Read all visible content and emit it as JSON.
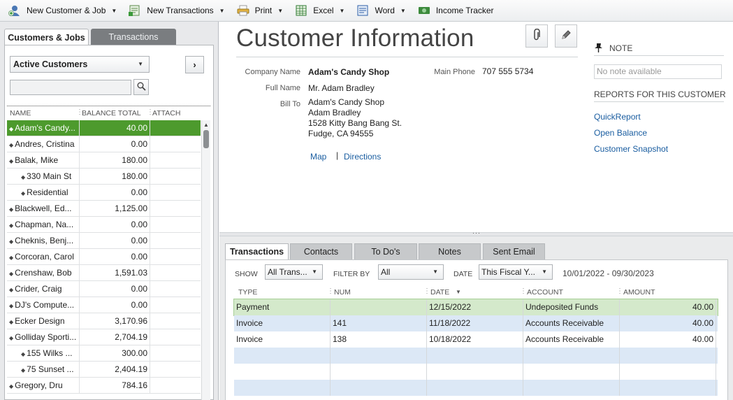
{
  "toolbar": {
    "items": [
      {
        "label": "New Customer & Job",
        "icon": "new-customer-icon",
        "has_menu": true
      },
      {
        "label": "New Transactions",
        "icon": "new-transactions-icon",
        "has_menu": true
      },
      {
        "label": "Print",
        "icon": "print-icon",
        "has_menu": true
      },
      {
        "label": "Excel",
        "icon": "excel-icon",
        "has_menu": true
      },
      {
        "label": "Word",
        "icon": "word-icon",
        "has_menu": true
      },
      {
        "label": "Income Tracker",
        "icon": "income-tracker-icon",
        "has_menu": false
      }
    ]
  },
  "left": {
    "tabs": {
      "customers_jobs": "Customers & Jobs",
      "transactions": "Transactions"
    },
    "filter": "Active Customers",
    "search_value": "",
    "columns": {
      "name": "NAME",
      "balance": "BALANCE TOTAL",
      "attach": "ATTACH"
    },
    "rows": [
      {
        "name": "Adam's Candy...",
        "balance": "40.00",
        "sub": false,
        "selected": true
      },
      {
        "name": "Andres, Cristina",
        "balance": "0.00",
        "sub": false
      },
      {
        "name": "Balak, Mike",
        "balance": "180.00",
        "sub": false
      },
      {
        "name": "330 Main St",
        "balance": "180.00",
        "sub": true
      },
      {
        "name": "Residential",
        "balance": "0.00",
        "sub": true
      },
      {
        "name": "Blackwell, Ed...",
        "balance": "1,125.00",
        "sub": false
      },
      {
        "name": "Chapman, Na...",
        "balance": "0.00",
        "sub": false
      },
      {
        "name": "Cheknis, Benj...",
        "balance": "0.00",
        "sub": false
      },
      {
        "name": "Corcoran, Carol",
        "balance": "0.00",
        "sub": false
      },
      {
        "name": "Crenshaw, Bob",
        "balance": "1,591.03",
        "sub": false
      },
      {
        "name": "Crider, Craig",
        "balance": "0.00",
        "sub": false
      },
      {
        "name": "DJ's Compute...",
        "balance": "0.00",
        "sub": false
      },
      {
        "name": "Ecker Design",
        "balance": "3,170.96",
        "sub": false
      },
      {
        "name": "Golliday Sporti...",
        "balance": "2,704.19",
        "sub": false
      },
      {
        "name": "155 Wilks ...",
        "balance": "300.00",
        "sub": true
      },
      {
        "name": "75 Sunset ...",
        "balance": "2,404.19",
        "sub": true
      },
      {
        "name": "Gregory, Dru",
        "balance": "784.16",
        "sub": false
      }
    ]
  },
  "info": {
    "title": "Customer Information",
    "labels": {
      "company": "Company Name",
      "full_name": "Full Name",
      "bill_to": "Bill To",
      "phone": "Main Phone"
    },
    "company": "Adam's Candy Shop",
    "full_name": "Mr. Adam  Bradley",
    "bill_to": [
      "Adam's Candy Shop",
      "Adam Bradley",
      "1528 Kitty Bang Bang St.",
      "Fudge, CA 94555"
    ],
    "phone": "707 555 5734",
    "map_link": "Map",
    "separator": "|",
    "directions_link": "Directions"
  },
  "note": {
    "title": "NOTE",
    "placeholder": "No note available",
    "reports_title": "REPORTS FOR THIS CUSTOMER",
    "reports": [
      "QuickReport",
      "Open Balance",
      "Customer Snapshot"
    ]
  },
  "bottom": {
    "tabs": [
      "Transactions",
      "Contacts",
      "To Do's",
      "Notes",
      "Sent Email"
    ],
    "filters": {
      "show_label": "SHOW",
      "show_value": "All Trans...",
      "filter_label": "FILTER BY",
      "filter_value": "All",
      "date_label": "DATE",
      "date_value": "This Fiscal Y...",
      "date_range": "10/01/2022 - 09/30/2023"
    },
    "columns": {
      "type": "TYPE",
      "num": "NUM",
      "date": "DATE",
      "account": "ACCOUNT",
      "amount": "AMOUNT"
    },
    "rows": [
      {
        "type": "Payment",
        "num": "",
        "date": "12/15/2022",
        "account": "Undeposited Funds",
        "amount": "40.00"
      },
      {
        "type": "Invoice",
        "num": "141",
        "date": "11/18/2022",
        "account": "Accounts Receivable",
        "amount": "40.00"
      },
      {
        "type": "Invoice",
        "num": "138",
        "date": "10/18/2022",
        "account": "Accounts Receivable",
        "amount": "40.00"
      }
    ]
  },
  "colors": {
    "selected_row": "#4d9a2d",
    "payment_row": "#d4e9cb",
    "alt_row": "#dce8f6",
    "link": "#1a5da0"
  }
}
